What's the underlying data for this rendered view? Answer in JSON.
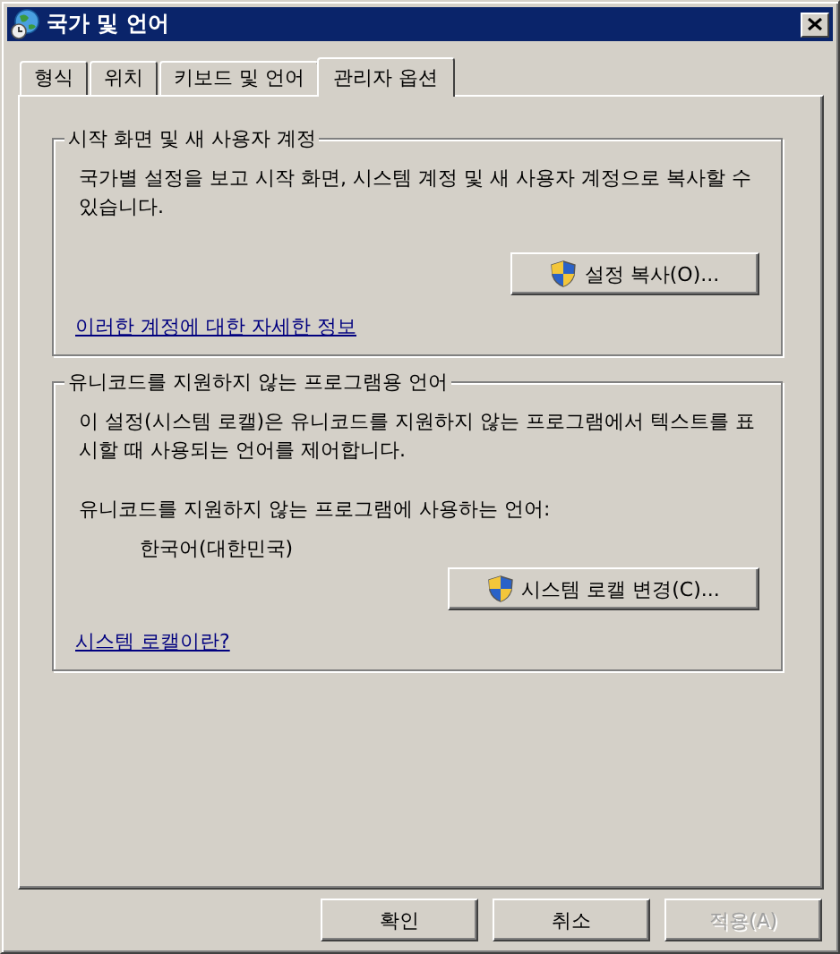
{
  "window": {
    "title": "국가 및 언어"
  },
  "tabs": [
    {
      "label": "형식",
      "selected": false
    },
    {
      "label": "위치",
      "selected": false
    },
    {
      "label": "키보드 및 언어",
      "selected": false
    },
    {
      "label": "관리자 옵션",
      "selected": true
    }
  ],
  "groups": [
    {
      "title": "시작 화면 및 새 사용자 계정",
      "description": "국가별 설정을 보고 시작 화면, 시스템 계정 및 새 사용자 계정으로 복사할 수 있습니다.",
      "button": "설정 복사(O)...",
      "link": "이러한 계정에 대한 자세한 정보"
    },
    {
      "title": "유니코드를 지원하지 않는 프로그램용 언어",
      "description": "이 설정(시스템 로캘)은 유니코드를 지원하지 않는 프로그램에서 텍스트를 표시할 때 사용되는 언어를 제어합니다.",
      "field_label": "유니코드를 지원하지 않는 프로그램에 사용하는 언어:",
      "field_value": "한국어(대한민국)",
      "button": "시스템 로캘 변경(C)...",
      "link": "시스템 로캘이란?"
    }
  ],
  "buttons": [
    {
      "label": "확인",
      "disabled": false
    },
    {
      "label": "취소",
      "disabled": false
    },
    {
      "label": "적용(A)",
      "disabled": true
    }
  ]
}
